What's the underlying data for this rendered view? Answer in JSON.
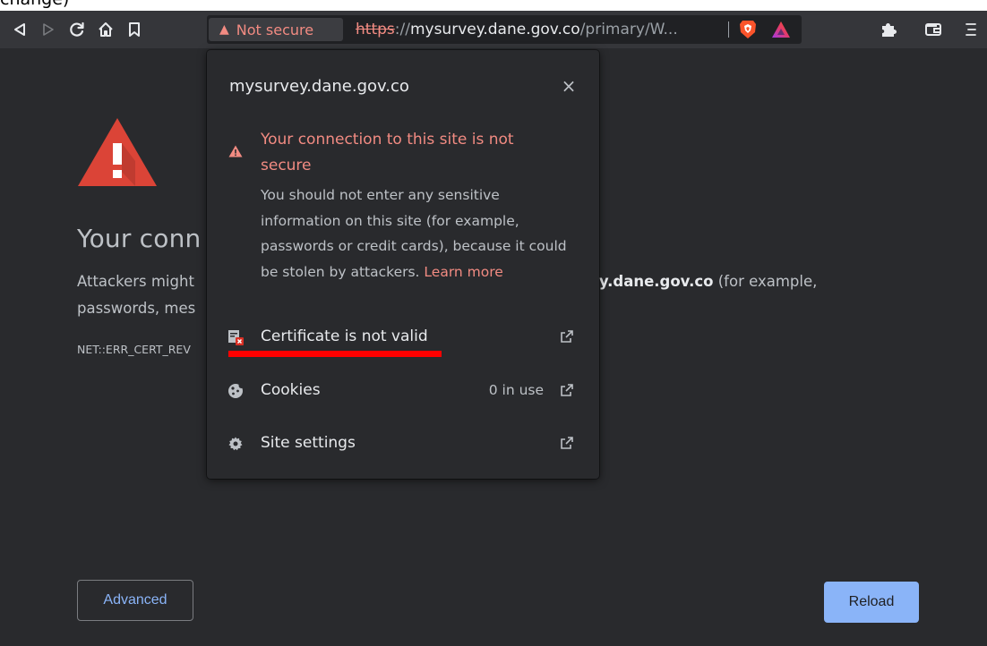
{
  "caption": {
    "text": "change)"
  },
  "toolbar": {
    "not_secure_label": "Not secure",
    "url_scheme": "https",
    "url_sep": "://",
    "url_host": "mysurvey.dane.gov.co",
    "url_path": "/primary/W..."
  },
  "popup": {
    "site": "mysurvey.dane.gov.co",
    "close_symbol": "×",
    "warning_title": "Your connection to this site is not secure",
    "warning_body": "You should not enter any sensitive information on this site (for example, passwords or credit cards), because it could be stolen by attackers.",
    "learn_more": "Learn more",
    "certificate_label": "Certificate is not valid",
    "cookies_label": "Cookies",
    "cookies_value": "0 in use",
    "site_settings_label": "Site settings"
  },
  "page": {
    "heading": "Your conn",
    "body_prefix": "Attackers might",
    "body_host": "vey.dane.gov.co",
    "body_suffix": " (for example,",
    "body_line2": "passwords, mes",
    "error_code": "NET::ERR_CERT_REV",
    "advanced_label": "Advanced",
    "reload_label": "Reload"
  },
  "colors": {
    "toolbar_bg": "#35363a",
    "page_bg": "#292a2d",
    "warning_red": "#f28b82",
    "link_blue": "#8ab4f8",
    "annotation_red": "#ff0000",
    "triangle_red": "#db4437"
  }
}
